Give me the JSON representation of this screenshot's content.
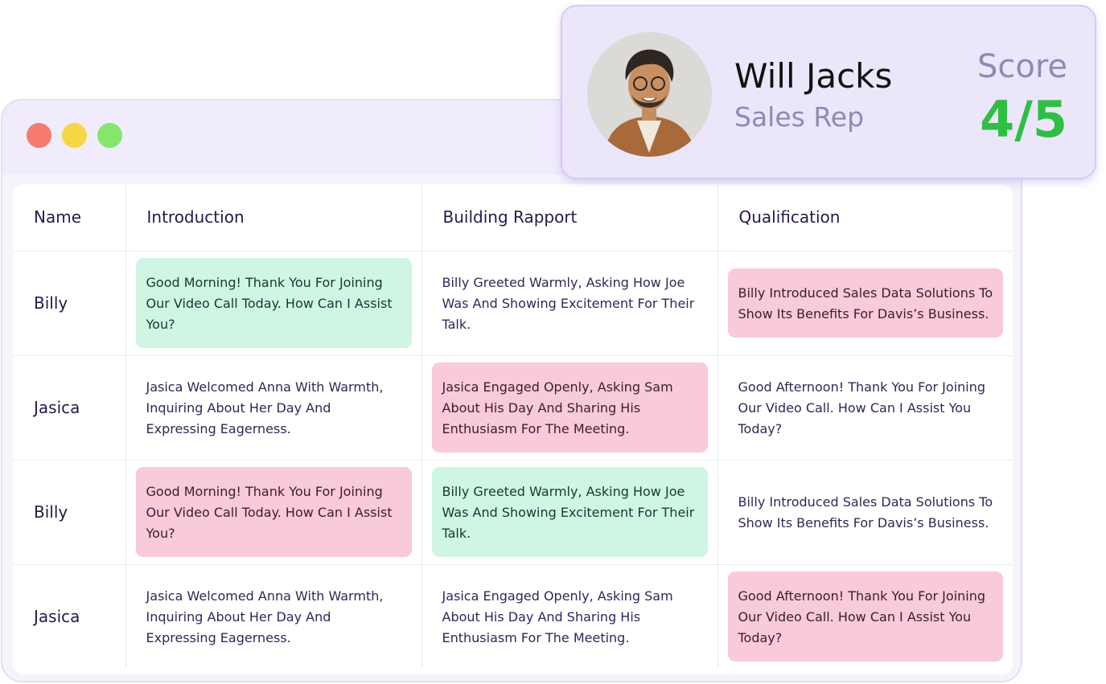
{
  "window": {
    "controls": [
      "close",
      "minimize",
      "maximize"
    ],
    "control_colors": {
      "close": "#f67a70",
      "minimize": "#f5d743",
      "maximize": "#87e669"
    }
  },
  "profile": {
    "name": "Will Jacks",
    "role": "Sales Rep",
    "score_label": "Score",
    "score_value": "4/5",
    "score_color": "#2fbf43"
  },
  "table": {
    "headers": [
      "Name",
      "Introduction",
      "Building Rapport",
      "Qualification"
    ],
    "rows": [
      {
        "name": "Billy",
        "cells": [
          {
            "text": "Good Morning! Thank You For Joining Our Video Call Today. How Can I Assist You?",
            "status": "green"
          },
          {
            "text": "Billy Greeted Warmly, Asking How Joe Was And Showing Excitement For Their Talk.",
            "status": "plain"
          },
          {
            "text": "Billy Introduced Sales Data Solutions To Show Its Benefits For Davis’s Business.",
            "status": "pink"
          }
        ]
      },
      {
        "name": "Jasica",
        "cells": [
          {
            "text": "Jasica Welcomed Anna With Warmth, Inquiring About Her Day And Expressing Eagerness.",
            "status": "plain"
          },
          {
            "text": "Jasica Engaged Openly, Asking Sam About His Day And Sharing His Enthusiasm For The Meeting.",
            "status": "pink"
          },
          {
            "text": "Good Afternoon! Thank You For Joining Our Video Call. How Can I Assist You Today?",
            "status": "plain"
          }
        ]
      },
      {
        "name": "Billy",
        "cells": [
          {
            "text": "Good Morning! Thank You For Joining Our Video Call Today. How Can I Assist You?",
            "status": "pink"
          },
          {
            "text": "Billy Greeted Warmly, Asking How Joe Was And Showing Excitement For Their Talk.",
            "status": "green"
          },
          {
            "text": "Billy Introduced Sales Data Solutions To Show Its Benefits For Davis’s Business.",
            "status": "plain"
          }
        ]
      },
      {
        "name": "Jasica",
        "cells": [
          {
            "text": "Jasica Welcomed Anna With Warmth, Inquiring About Her Day And Expressing Eagerness.",
            "status": "plain"
          },
          {
            "text": "Jasica Engaged Openly, Asking Sam About His Day And Sharing His Enthusiasm For The Meeting.",
            "status": "plain"
          },
          {
            "text": "Good Afternoon! Thank You For Joining Our Video Call. How Can I Assist You Today?",
            "status": "pink"
          }
        ]
      }
    ]
  }
}
